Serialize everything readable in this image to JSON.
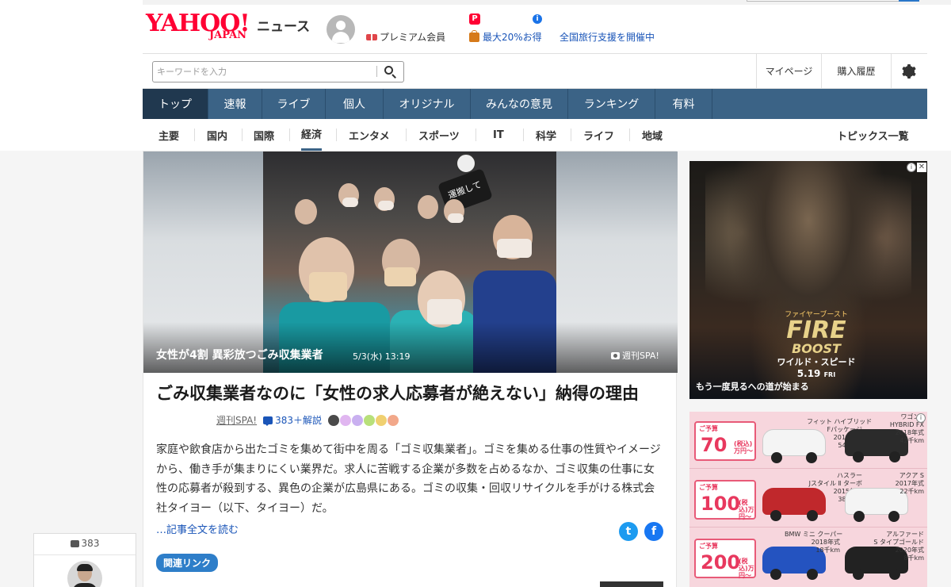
{
  "header": {
    "logo_main": "YAHOO!",
    "logo_sub": "JAPAN",
    "section": "ニュース",
    "premium": "プレミアム会員",
    "promo_icon1": "P",
    "promo1": "最大20%お得",
    "promo_icon2": "i",
    "promo2": "全国旅行支援を開催中"
  },
  "search": {
    "placeholder": "キーワードを入力",
    "mypage": "マイページ",
    "history": "購入履歴"
  },
  "main_nav": [
    "トップ",
    "速報",
    "ライブ",
    "個人",
    "オリジナル",
    "みんなの意見",
    "ランキング",
    "有料"
  ],
  "sub_nav": [
    "主要",
    "国内",
    "国際",
    "経済",
    "エンタメ",
    "スポーツ",
    "IT",
    "科学",
    "ライフ",
    "地域"
  ],
  "topics_link": "トピックス一覧",
  "hero": {
    "sign_text": "運搬して",
    "caption": "女性が4割 異彩放つごみ収集業者",
    "date": "5/3(水) 13:19",
    "source": "週刊SPA!"
  },
  "article": {
    "title": "ごみ収集業者なのに「女性の求人応募者が絶えない」納得の理由",
    "source": "週刊SPA!",
    "comments": "383＋解説",
    "body": "家庭や飲食店から出たゴミを集めて街中を周る「ゴミ収集業者」。ゴミを集める仕事の性質やイメージから、働き手が集まりにくい業界だ。求人に苦戦する企業が多数を占めるなか、ゴミ収集の仕事に女性の応募者が殺到する、異色の企業が広島県にある。ゴミの収集・回収リサイクルを手がける株式会社タイヨー（以下、タイヨー）だ。",
    "read_more": "…記事全文を読む",
    "twitter_icon": "t",
    "facebook_icon": "f",
    "related": "関連リンク"
  },
  "ad1": {
    "jp_title": "ファイヤーブースト",
    "title_line1": "FIRE",
    "title_line2": "BOOST",
    "subtitle": "ワイルド・スピード",
    "date": "5.19",
    "day": "FRI",
    "tagline": "もう一度見るへの道が始まる",
    "info_icon": "i",
    "close_icon": "✕"
  },
  "ad2": {
    "info_icon": "i",
    "rows": [
      {
        "label": "ご予算",
        "price": "70",
        "unit": "(税込)万円〜",
        "car1": "フィット ハイブリッド\nFパッケージ\n2015年式\n54千km",
        "car2": "ワゴンR\nHYBRID FX\n2018年式\n42千km"
      },
      {
        "label": "ご予算",
        "price": "100",
        "unit": "(税込)万円〜",
        "car1": "ハスラー\nJスタイル Ⅱ ターボ\n2015年式\n38千km",
        "car2": "アクア S\n2017年式\n22千km"
      },
      {
        "label": "ご予算",
        "price": "200",
        "unit": "(税込)万円〜",
        "car1": "BMW ミニ クーパー\n2018年式\n18千km",
        "car2": "アルファード\nS タイプゴールド\n2020年式\n8千km"
      }
    ]
  },
  "float": {
    "count": "383"
  }
}
